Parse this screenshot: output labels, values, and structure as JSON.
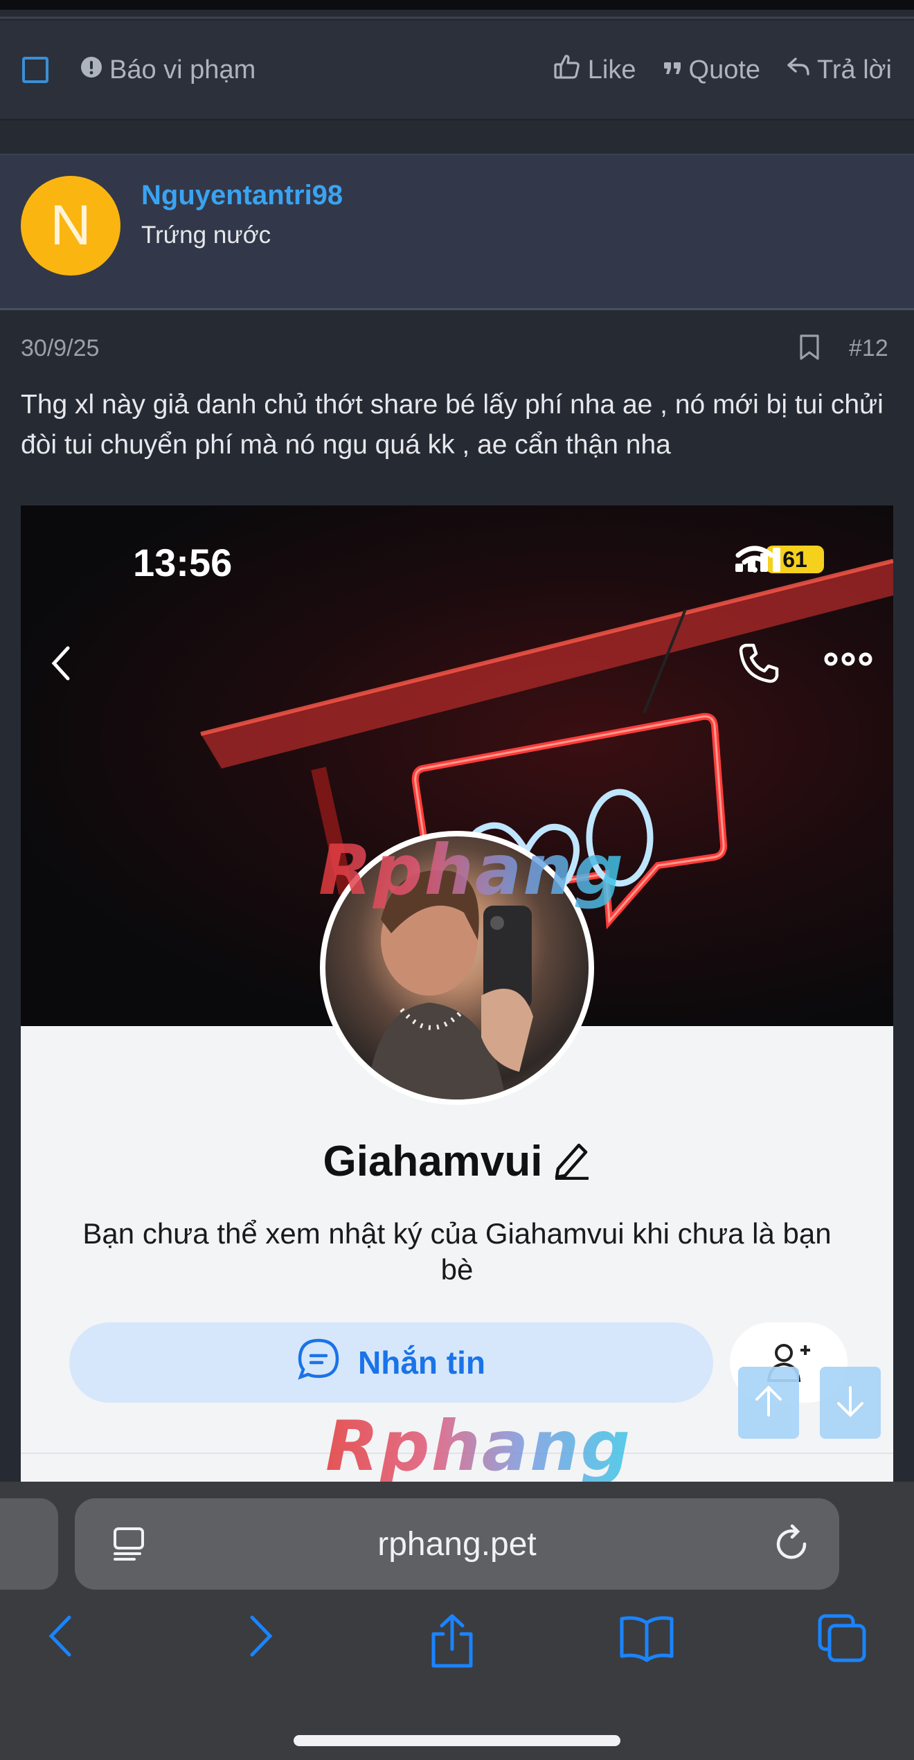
{
  "action_bar": {
    "report_label": "Báo vi phạm",
    "like_label": "Like",
    "quote_label": "Quote",
    "reply_label": "Trả lời"
  },
  "author": {
    "avatar_letter": "N",
    "avatar_color": "#fbb511",
    "username": "Nguyentantri98",
    "title": "Trứng nước"
  },
  "post": {
    "date": "30/9/25",
    "number": "#12",
    "text": "Thg xl này giả danh chủ thớt share bé lấy phí nha ae , nó mới bị tui chửi đòi tui chuyển phí mà nó ngu quá kk , ae cẩn thận nha"
  },
  "attachment": {
    "time": "13:56",
    "battery": "61",
    "watermark": "Rphang",
    "profile_name": "Giahamvui",
    "profile_note": "Bạn chưa thể xem nhật ký của Giahamvui khi chưa là bạn bè",
    "message_button": "Nhắn tin"
  },
  "browser": {
    "url": "rphang.pet"
  },
  "colors": {
    "accent": "#3aa3f2",
    "background": "#262a33",
    "message_blue": "#1a73e8"
  }
}
